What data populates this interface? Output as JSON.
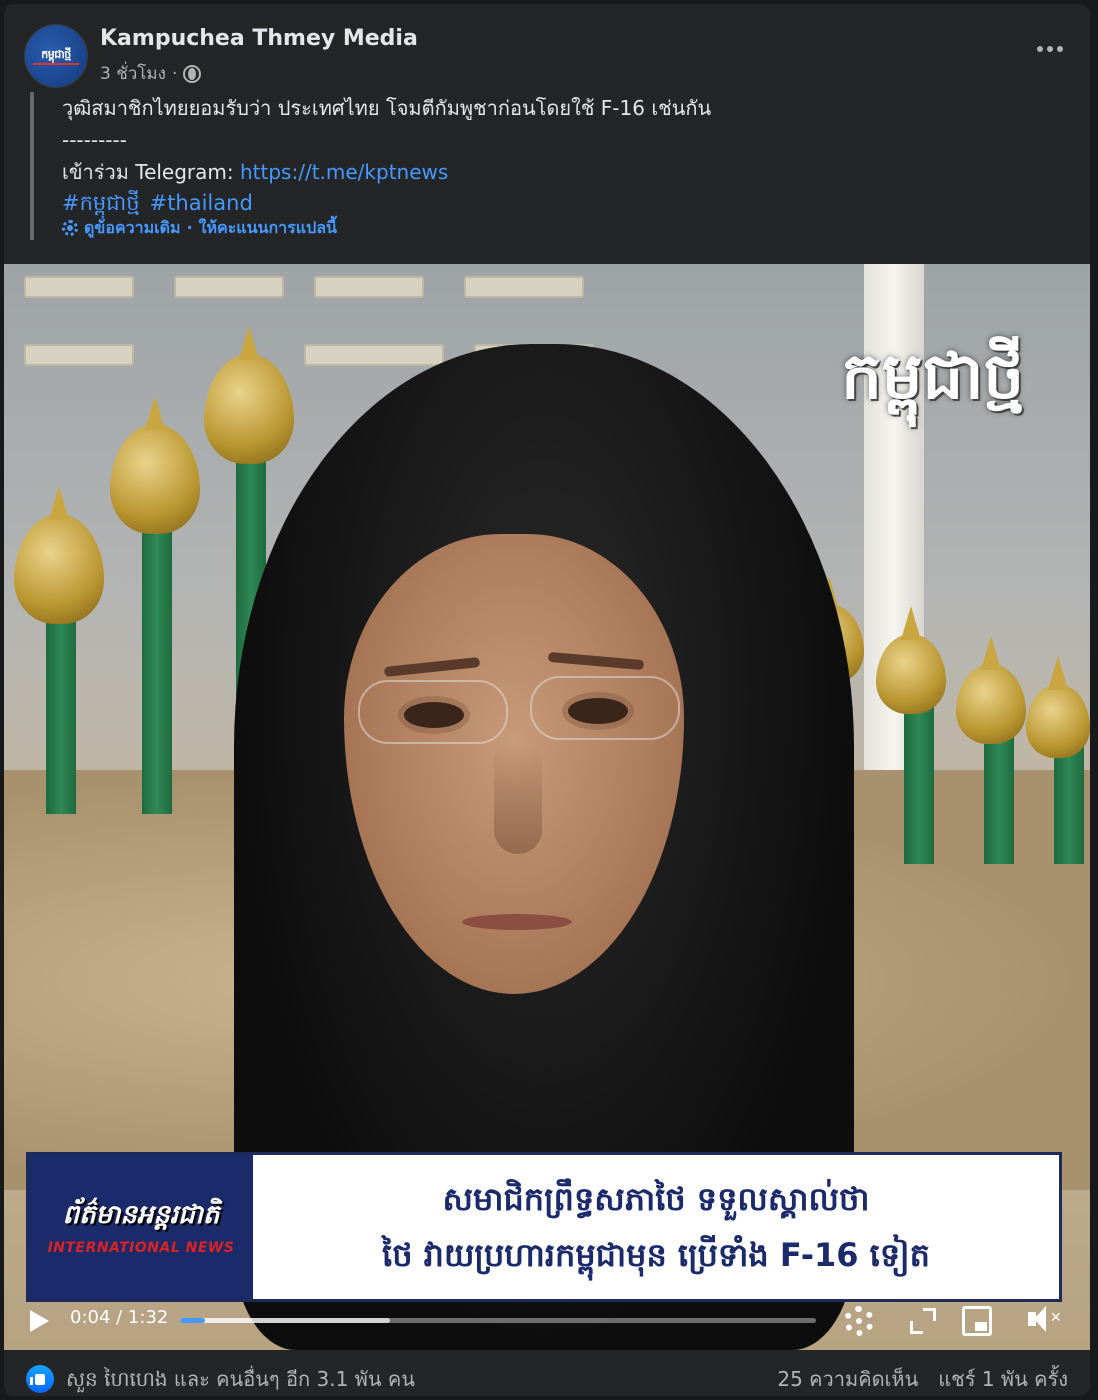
{
  "post": {
    "page_name": "Kampuchea Thmey Media",
    "avatar_text": "កម្ពុជាថ្មី",
    "time": "3 ชั่วโมง",
    "separator": "·",
    "more_icon": "more-horizontal-icon",
    "audience_icon": "globe-icon"
  },
  "content": {
    "line1": "วุฒิสมาชิกไทยยอมรับว่า ประเทศไทย โจมตีกัมพูชาก่อนโดยใช้ F-16 เช่นกัน",
    "divider": "---------",
    "telegram_label": "เข้าร่วม Telegram: ",
    "telegram_link": "https://t.me/kptnews",
    "hashtags": [
      "#កម្ពុជាថ្មី",
      "#thailand"
    ],
    "see_original": "ดูข้อความเดิม",
    "translate_sep": "·",
    "rate_translation": "ให้คะแนนการแปลนี้"
  },
  "video": {
    "watermark": "កម្ពុជាថ្មី",
    "lower_third_left_title": "ព័ត៌មានអន្តរជាតិ",
    "lower_third_left_sub": "INTERNATIONAL NEWS",
    "lower_third_line1": "សមាជិកព្រឹទ្ធសភាថៃ ទទួលស្គាល់ថា",
    "lower_third_line2": "ថៃ វាយប្រហារកម្ពុជាមុន ប្រើទាំង F-16 ទៀត",
    "time_display": "0:04 / 1:32",
    "progress": 0.04,
    "buffered": 0.33
  },
  "footer": {
    "reactions": "សួន ហៃហេង และ คนอื่นๆ อีก 3.1 พัน คน",
    "comments": "25 ความคิดเห็น",
    "shares": "แชร์ 1 พัน ครั้ง"
  }
}
